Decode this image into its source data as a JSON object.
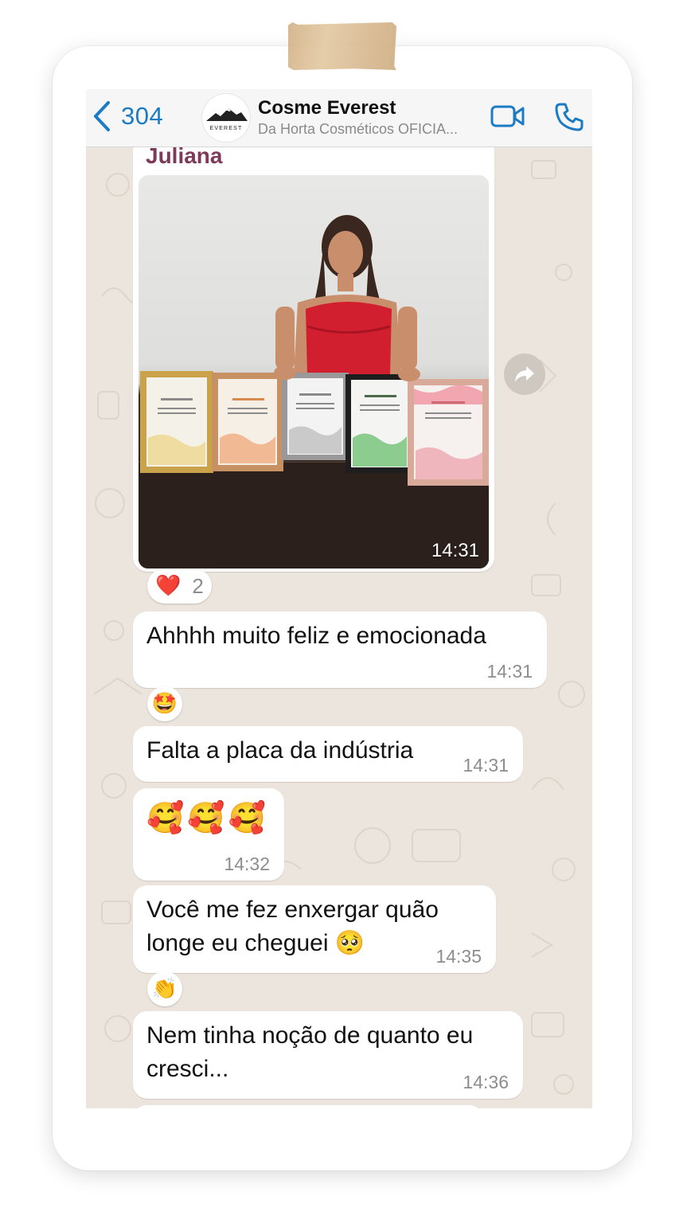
{
  "header": {
    "back_count": "304",
    "contact_name": "Cosme Everest",
    "contact_subtitle": "Da Horta Cosméticos OFICIA...",
    "avatar_text": "EVEREST"
  },
  "messages": [
    {
      "sender": "Juliana",
      "type": "image",
      "time": "14:31",
      "reaction_icon": "❤️",
      "reaction_count": "2"
    },
    {
      "type": "text",
      "text": "Ahhhh muito feliz e emocionada",
      "time": "14:31",
      "reaction_icon": "🤩"
    },
    {
      "type": "text",
      "text": "Falta a placa da indústria",
      "time": "14:31"
    },
    {
      "type": "text",
      "text": "🥰🥰🥰",
      "time": "14:32"
    },
    {
      "type": "text",
      "line1": "Você me fez enxergar quão",
      "line2": "longe eu cheguei 🥺",
      "time": "14:35",
      "reaction_icon": "👏"
    },
    {
      "type": "text",
      "line1": "Nem tinha noção de quanto eu",
      "line2": "cresci...",
      "time": "14:36"
    }
  ],
  "colors": {
    "accent": "#1c7bc5",
    "sender": "#7d3a59",
    "chat_background": "#ece5dd",
    "bubble": "#ffffff"
  },
  "icons": [
    "back-chevron-icon",
    "video-call-icon",
    "phone-call-icon",
    "forward-icon"
  ]
}
